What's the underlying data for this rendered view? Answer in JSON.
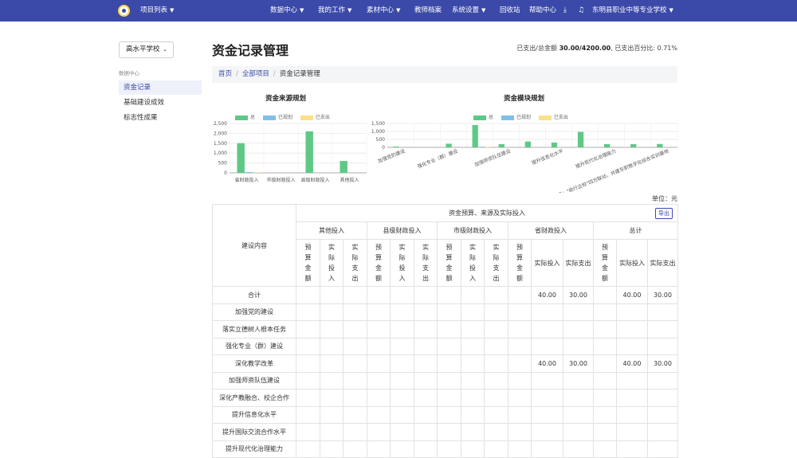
{
  "topbar": {
    "project_menu": "项目列表",
    "nav": [
      "数据中心",
      "我的工作",
      "素材中心",
      "教师档案",
      "系统设置",
      "回收站",
      "帮助中心"
    ],
    "school": "东明县职业中等专业学校"
  },
  "sidebar": {
    "school_select": "高水平学校",
    "section": "数据中心",
    "items": [
      {
        "label": "资金记录",
        "active": true
      },
      {
        "label": "基础建设成效",
        "active": false
      },
      {
        "label": "标志性成果",
        "active": false
      }
    ]
  },
  "page": {
    "title": "资金记录管理",
    "summary_label1": "已支出/总金额",
    "summary_value": "30.00/4200.00",
    "summary_label2": "已支出百分比:",
    "summary_pct": "0.71%"
  },
  "breadcrumb": [
    "首页",
    "全部项目",
    "资金记录管理"
  ],
  "colors": {
    "total": "#5ec985",
    "planned": "#7ec0e8",
    "spent": "#fbe088",
    "brand": "#3b4aa8"
  },
  "chart_data": [
    {
      "type": "bar",
      "title": "资金来源规划",
      "legend": [
        "总",
        "已规划",
        "已支出"
      ],
      "categories": [
        "省财政投入",
        "市级财政投入",
        "县级财政投入",
        "其他投入"
      ],
      "ylim": [
        0,
        2500
      ],
      "yticks": [
        "0",
        "500",
        "1,000",
        "1,500",
        "2,000",
        "2,500"
      ],
      "series": [
        {
          "name": "总",
          "values": [
            1500,
            0,
            2100,
            600
          ]
        },
        {
          "name": "已规划",
          "values": [
            40,
            0,
            0,
            0
          ]
        },
        {
          "name": "已支出",
          "values": [
            30,
            0,
            0,
            0
          ]
        }
      ]
    },
    {
      "type": "bar",
      "title": "资金模块规划",
      "legend": [
        "总",
        "已规划",
        "已支出"
      ],
      "categories": [
        "加强党的建设",
        "落实立德树人根本任务",
        "强化专业（群）建设",
        "深化教学改革",
        "加强师资队伍建设",
        "深化产教融合、校企合作",
        "提升信息化水平",
        "提升国际交流合作水平",
        "提升现代化治理能力",
        "特色项目：\"政行企校\"四方联动，共建东职数字化综合实训基地"
      ],
      "xlabels_shown": [
        "加强党的建设",
        "强化专业（群）建设",
        "加强师资队伍建设",
        "提升信息化水平",
        "提升现代化治理能力",
        "特色项目：\"政行企校\"四方联动，共建东职数字化综合实训基地"
      ],
      "ylim": [
        0,
        1500
      ],
      "yticks": [
        "0",
        "500",
        "1,000",
        "1,500"
      ],
      "series": [
        {
          "name": "总",
          "values": [
            50,
            0,
            230,
            1400,
            200,
            370,
            300,
            970,
            200,
            200,
            210
          ]
        },
        {
          "name": "已规划",
          "values": [
            0,
            0,
            0,
            40,
            0,
            0,
            0,
            0,
            0,
            0,
            0
          ]
        },
        {
          "name": "已支出",
          "values": [
            0,
            0,
            0,
            30,
            0,
            0,
            0,
            0,
            0,
            0,
            0
          ]
        }
      ]
    }
  ],
  "table": {
    "unit": "单位：元",
    "row_header": "建设内容",
    "group_header": "资金预算、来源及实际投入",
    "export_label": "导出",
    "groups": [
      "其他投入",
      "县级财政投入",
      "市级财政投入",
      "省财政投入",
      "总计"
    ],
    "sub_narrow": [
      "预算金额",
      "实际投入",
      "实际支出"
    ],
    "sub_wide_invest": "实际投入",
    "sub_wide_spent": "实际支出",
    "rows": [
      {
        "name": "合计",
        "prov_invest": "40.00",
        "prov_spent": "30.00",
        "total_invest": "40.00",
        "total_spent": "30.00"
      },
      {
        "name": "加强党的建设"
      },
      {
        "name": "落实立德树人根本任务"
      },
      {
        "name": "强化专业（群）建设"
      },
      {
        "name": "深化教学改革",
        "prov_invest": "40.00",
        "prov_spent": "30.00",
        "total_invest": "40.00",
        "total_spent": "30.00"
      },
      {
        "name": "加强师资队伍建设"
      },
      {
        "name": "深化产教融合、校企合作"
      },
      {
        "name": "提升信息化水平"
      },
      {
        "name": "提升国际交流合作水平"
      },
      {
        "name": "提升现代化治理能力"
      }
    ]
  }
}
